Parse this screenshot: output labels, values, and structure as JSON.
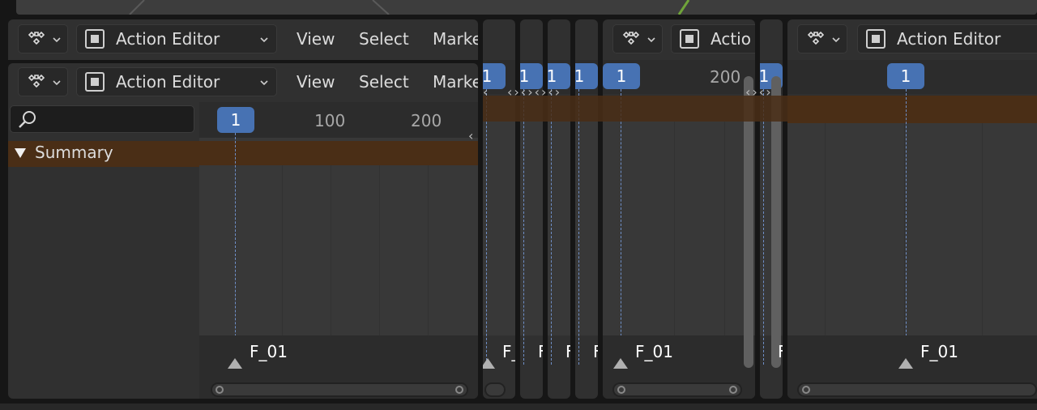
{
  "editor": {
    "type_label": "Action Editor",
    "menus": {
      "view": "View",
      "select": "Select",
      "marker": "Marke"
    },
    "truncated_label": "Actio"
  },
  "search": {
    "placeholder": ""
  },
  "channels": {
    "summary": "Summary"
  },
  "timeline": {
    "current_frame": "1",
    "ticks": [
      "100",
      "200"
    ],
    "tick_200": "200"
  },
  "marker": {
    "name": "F_01",
    "short": "F_",
    "tiny": "F"
  },
  "colors": {
    "accent": "#4772b3",
    "summary": "#4a2e16",
    "panel": "#303030"
  }
}
